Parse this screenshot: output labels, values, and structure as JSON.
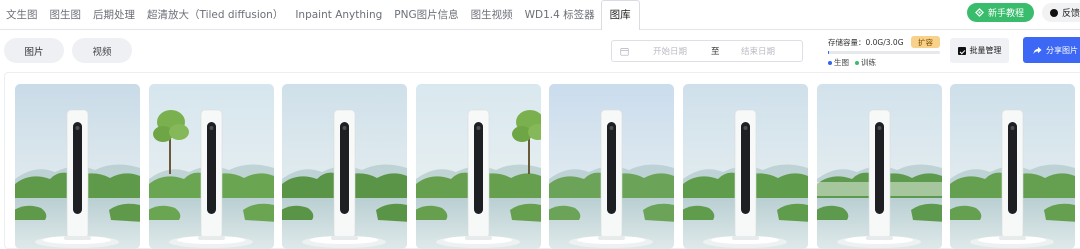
{
  "tabs": [
    {
      "label": "文生图"
    },
    {
      "label": "图生图"
    },
    {
      "label": "后期处理"
    },
    {
      "label": "超清放大（Tiled diffusion）"
    },
    {
      "label": "Inpaint Anything"
    },
    {
      "label": "PNG图片信息"
    },
    {
      "label": "图生视频"
    },
    {
      "label": "WD1.4 标签器"
    },
    {
      "label": "图库"
    }
  ],
  "active_tab": "图库",
  "header_buttons": {
    "tutorial": "新手教程",
    "feedback": "反馈建"
  },
  "media_toggle": {
    "images": "图片",
    "videos": "视频"
  },
  "date_range": {
    "start_placeholder": "开始日期",
    "separator": "至",
    "end_placeholder": "结束日期"
  },
  "storage": {
    "label": "存储容量：0.0G/3.0G",
    "used_fraction": 0.01,
    "expand": "扩容",
    "legend": [
      {
        "label": "生图",
        "color": "#2e65f3"
      },
      {
        "label": "训练",
        "color": "#39bd6c"
      }
    ]
  },
  "actions": {
    "batch_manage": "批量管理",
    "share": "分享图片"
  },
  "gallery": {
    "images": [
      {
        "variant": 0
      },
      {
        "variant": 1
      },
      {
        "variant": 2
      },
      {
        "variant": 3
      },
      {
        "variant": 4
      },
      {
        "variant": 5
      },
      {
        "variant": 6
      },
      {
        "variant": 7
      }
    ]
  },
  "colors": {
    "accent": "#3c68f5",
    "green": "#39bd6c",
    "storage_badge": "#f8d28a"
  }
}
